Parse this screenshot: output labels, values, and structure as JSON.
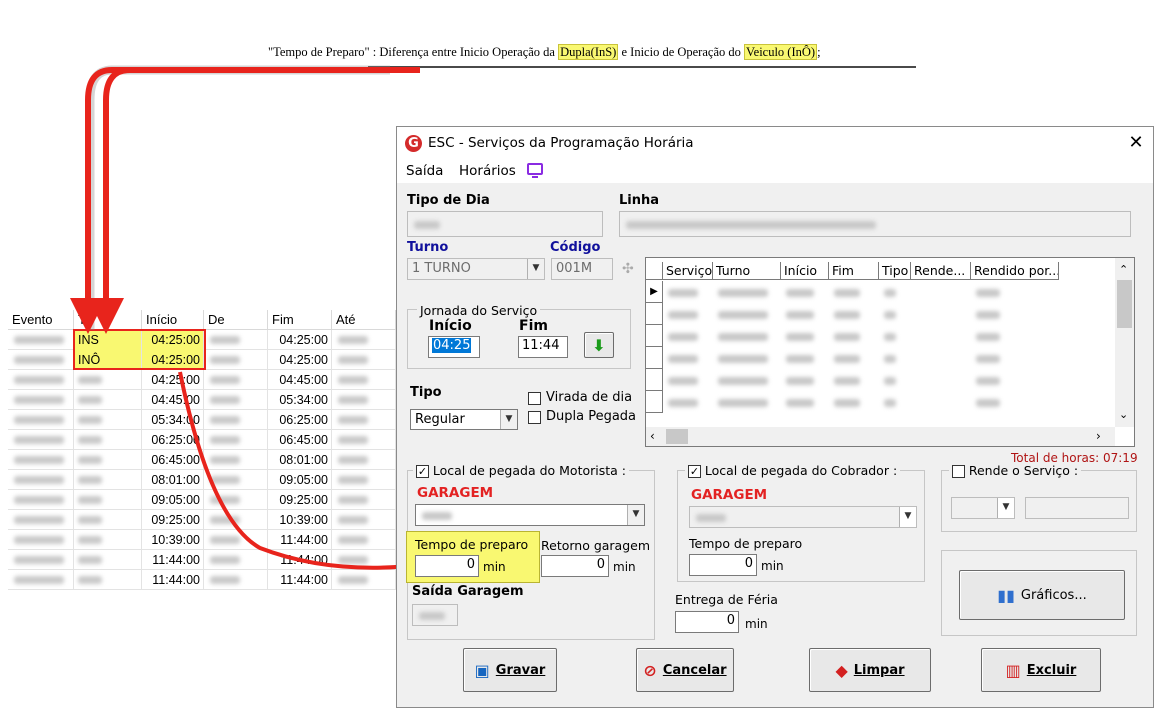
{
  "annotation": {
    "prefix": "\"Tempo de Preparo\" : Diferença entre Inicio Operação da ",
    "hl1": "Dupla(InS)",
    "middle": " e Inicio de Operação do ",
    "hl2": "Veiculo (InÔ)",
    "suffix": ";"
  },
  "sheet": {
    "headers": [
      "Evento",
      "Ti",
      "Início",
      "De",
      "Fim",
      "Até"
    ],
    "rows": [
      {
        "tipo": "INS",
        "inicio": "04:25:00",
        "fim": "04:25:00"
      },
      {
        "tipo": "INÔ",
        "inicio": "04:25:00",
        "fim": "04:25:00"
      },
      {
        "tipo": "",
        "inicio": "04:25:00",
        "fim": "04:45:00"
      },
      {
        "tipo": "",
        "inicio": "04:45:00",
        "fim": "05:34:00"
      },
      {
        "tipo": "",
        "inicio": "05:34:00",
        "fim": "06:25:00"
      },
      {
        "tipo": "",
        "inicio": "06:25:00",
        "fim": "06:45:00"
      },
      {
        "tipo": "",
        "inicio": "06:45:00",
        "fim": "08:01:00"
      },
      {
        "tipo": "",
        "inicio": "08:01:00",
        "fim": "09:05:00"
      },
      {
        "tipo": "",
        "inicio": "09:05:00",
        "fim": "09:25:00"
      },
      {
        "tipo": "",
        "inicio": "09:25:00",
        "fim": "10:39:00"
      },
      {
        "tipo": "",
        "inicio": "10:39:00",
        "fim": "11:44:00"
      },
      {
        "tipo": "",
        "inicio": "11:44:00",
        "fim": "11:44:00"
      },
      {
        "tipo": "",
        "inicio": "11:44:00",
        "fim": "11:44:00"
      }
    ]
  },
  "dialog": {
    "title": "ESC - Serviços da Programação Horária",
    "logo": "G",
    "close": "✕",
    "menu": [
      "Saída",
      "Horários"
    ],
    "tipo_de_dia_label": "Tipo de Dia",
    "linha_label": "Linha",
    "turno_label": "Turno",
    "turno_value": "1 TURNO",
    "codigo_label": "Código",
    "codigo_value": "001M",
    "jornada": {
      "legend": "Jornada do Serviço",
      "inicio_label": "Início",
      "fim_label": "Fim",
      "inicio_value": "04:25",
      "fim_value": "11:44"
    },
    "tipo_label": "Tipo",
    "tipo_value": "Regular",
    "virada_label": "Virada de dia",
    "dupla_label": "Dupla Pegada",
    "grid_headers": [
      "Serviço",
      "Turno",
      "Início",
      "Fim",
      "Tipo",
      "Rende...",
      "Rendido por..."
    ],
    "total_horas": "Total de horas: 07:19",
    "motorista": {
      "legend": "Local de pegada do Motorista :",
      "local": "GARAGEM",
      "tempo_label": "Tempo de preparo",
      "tempo_value": "0",
      "retorno_label": "Retorno garagem",
      "retorno_value": "0",
      "saida_label": "Saída Garagem",
      "min": "min"
    },
    "cobrador": {
      "legend": "Local de pegada do Cobrador :",
      "local": "GARAGEM",
      "tempo_label": "Tempo de preparo",
      "tempo_value": "0",
      "entrega_label": "Entrega de Féria",
      "entrega_value": "0",
      "min": "min"
    },
    "rende_label": "Rende o Serviço :",
    "graficos_label": "Gráficos...",
    "buttons": {
      "gravar": "Gravar",
      "cancelar": "Cancelar",
      "limpar": "Limpar",
      "excluir": "Excluir"
    }
  }
}
